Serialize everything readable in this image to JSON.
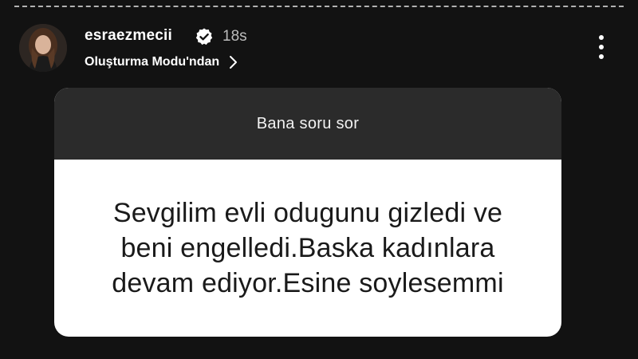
{
  "story": {
    "username": "esraezmecii",
    "verified_icon": "verified-badge-icon",
    "time_ago": "18s",
    "mode_label": "Oluşturma Modu'ndan",
    "mode_chevron_icon": "chevron-right-icon",
    "more_icon": "more-vertical-icon",
    "avatar_icon": "profile-avatar"
  },
  "question_sticker": {
    "prompt": "Bana soru sor",
    "answer_lines": [
      "Sevgilim evli odugunu gizledi ve",
      "beni engelledi.Baska kadınlara",
      "devam ediyor.Esine soylesemmi"
    ]
  },
  "colors": {
    "background": "#121212",
    "card_header": "#2b2b2b",
    "card_body": "#ffffff",
    "verified": "#ffffff"
  }
}
